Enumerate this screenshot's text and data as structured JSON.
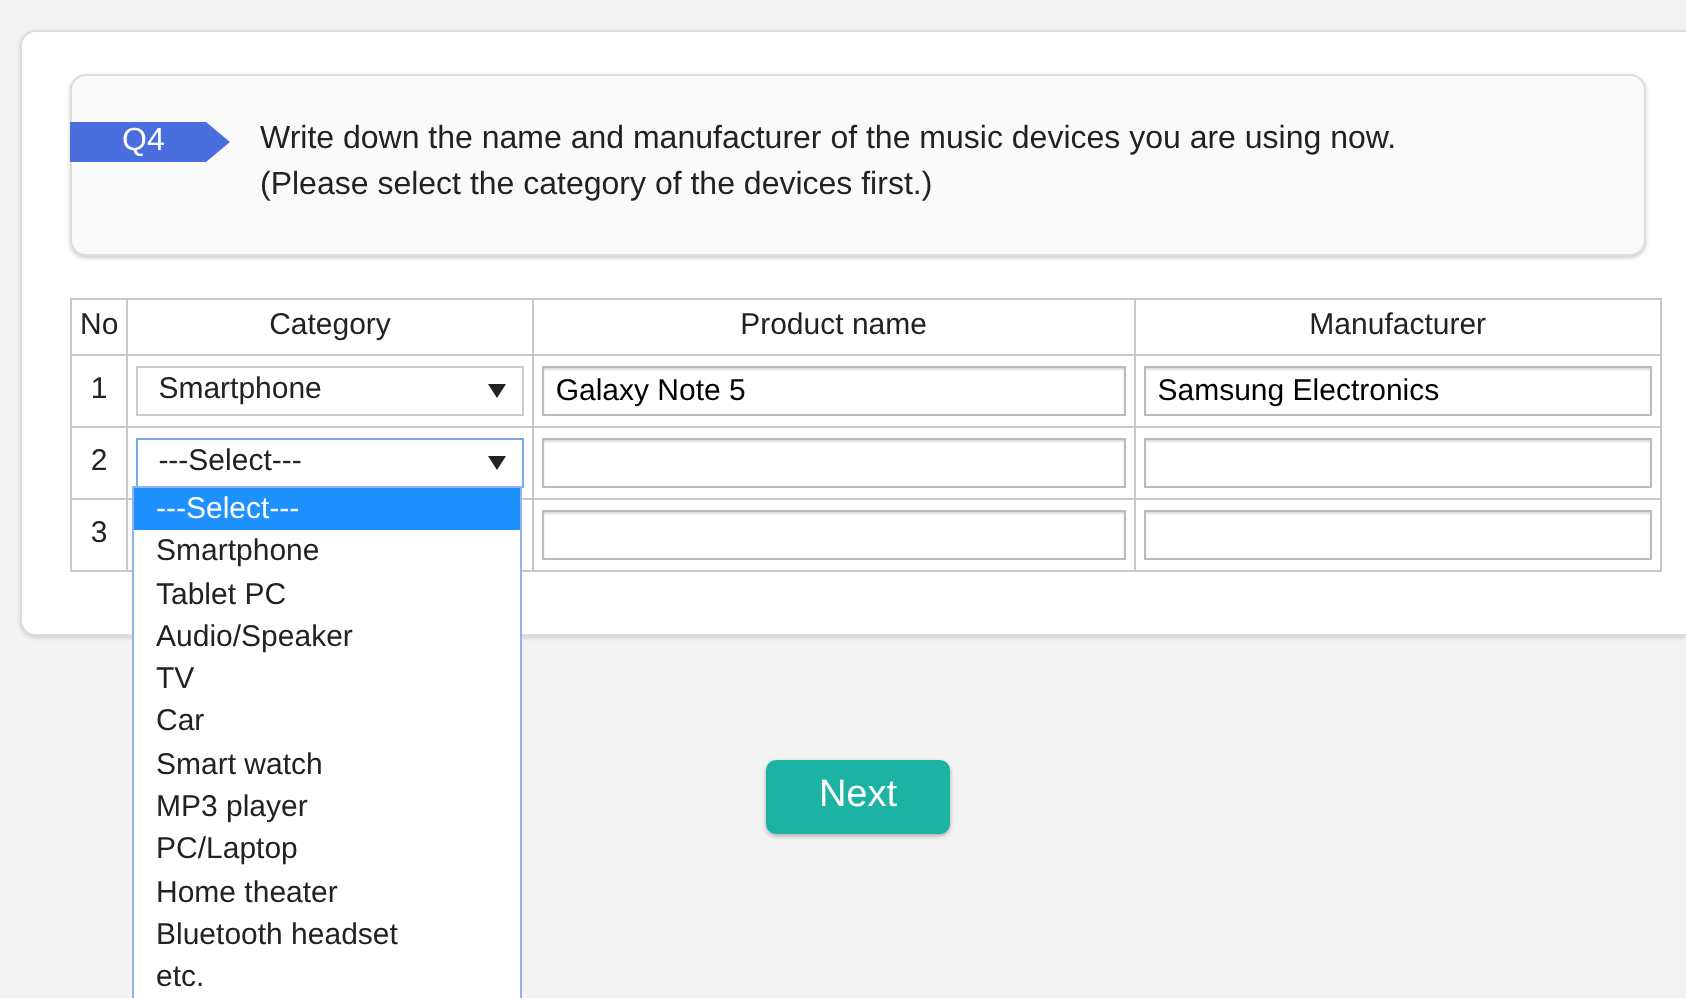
{
  "question": {
    "number": "Q4",
    "lines": [
      "Write down the name and manufacturer of the music devices you are using now.",
      "(Please select the category of the devices first.)"
    ]
  },
  "table": {
    "columns": [
      "No",
      "Category",
      "Product name",
      "Manufacturer"
    ],
    "rows": [
      {
        "no": "1",
        "category": "Smartphone",
        "focused": false,
        "product": "Galaxy Note 5",
        "manufacturer": "Samsung Electronics"
      },
      {
        "no": "2",
        "category": "---Select---",
        "focused": true
      },
      {
        "no": "3"
      }
    ]
  },
  "dropdown": {
    "options": [
      {
        "label": "---Select---",
        "selected": true
      },
      {
        "label": "Smartphone",
        "selected": false
      },
      {
        "label": "Tablet PC",
        "selected": false
      },
      {
        "label": "Audio/Speaker",
        "selected": false
      },
      {
        "label": "TV",
        "selected": false
      },
      {
        "label": "Car",
        "selected": false
      },
      {
        "label": "Smart watch",
        "selected": false
      },
      {
        "label": "MP3 player",
        "selected": false
      },
      {
        "label": "PC/Laptop",
        "selected": false
      },
      {
        "label": "Home theater",
        "selected": false
      },
      {
        "label": "Bluetooth headset",
        "selected": false
      },
      {
        "label": "etc.",
        "selected": false
      }
    ]
  },
  "next_button": "Next"
}
